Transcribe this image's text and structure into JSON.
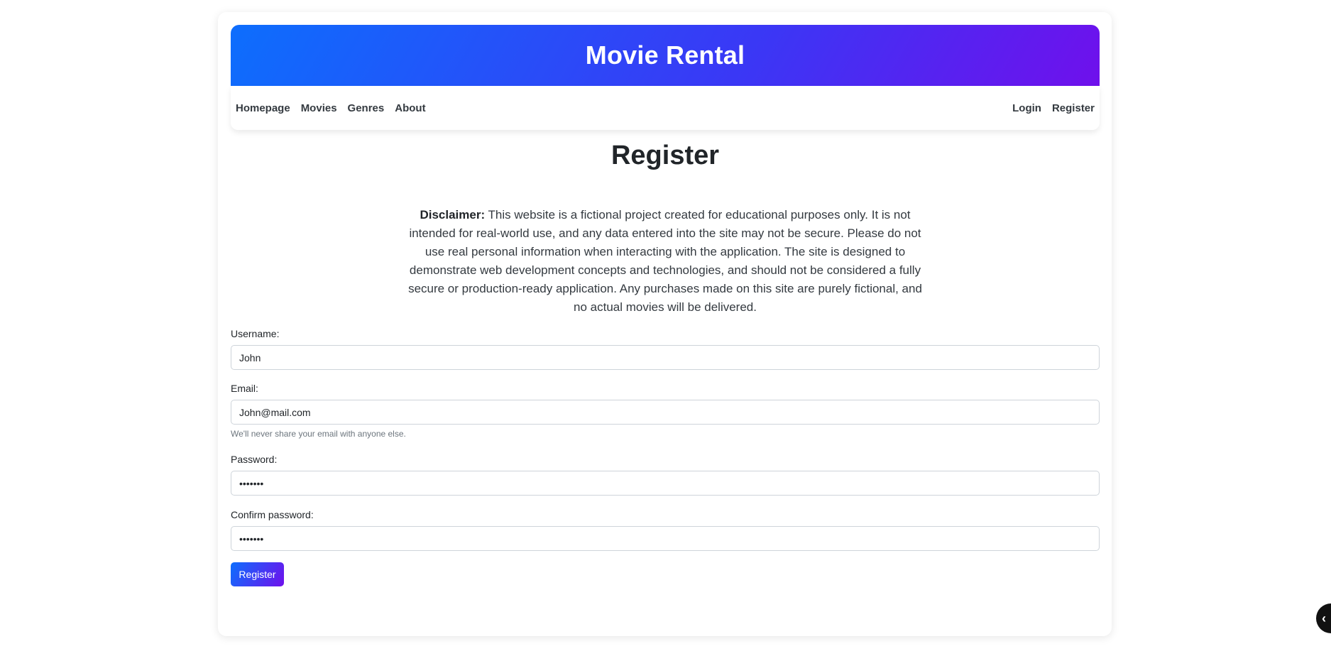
{
  "colors": {
    "gradient_start": "#0d6efd",
    "gradient_end": "#6f10ec"
  },
  "header": {
    "title": "Movie Rental"
  },
  "nav": {
    "left": [
      {
        "label": "Homepage"
      },
      {
        "label": "Movies"
      },
      {
        "label": "Genres"
      },
      {
        "label": "About"
      }
    ],
    "right": [
      {
        "label": "Login"
      },
      {
        "label": "Register"
      }
    ]
  },
  "main": {
    "title": "Register",
    "disclaimer_label": "Disclaimer:",
    "disclaimer_text": " This website is a fictional project created for educational purposes only. It is not intended for real-world use, and any data entered into the site may not be secure. Please do not use real personal information when interacting with the application. The site is designed to demonstrate web development concepts and technologies, and should not be considered a fully secure or production-ready application. Any purchases made on this site are purely fictional, and no actual movies will be delivered."
  },
  "form": {
    "username": {
      "label": "Username:",
      "value": "John"
    },
    "email": {
      "label": "Email:",
      "value": "John@mail.com",
      "help": "We'll never share your email with anyone else."
    },
    "password": {
      "label": "Password:",
      "value": "•••••••"
    },
    "confirm_password": {
      "label": "Confirm password:",
      "value": "•••••••"
    },
    "submit_label": "Register"
  },
  "floating_button": {
    "icon": "chevron-left-icon",
    "glyph": "‹"
  }
}
